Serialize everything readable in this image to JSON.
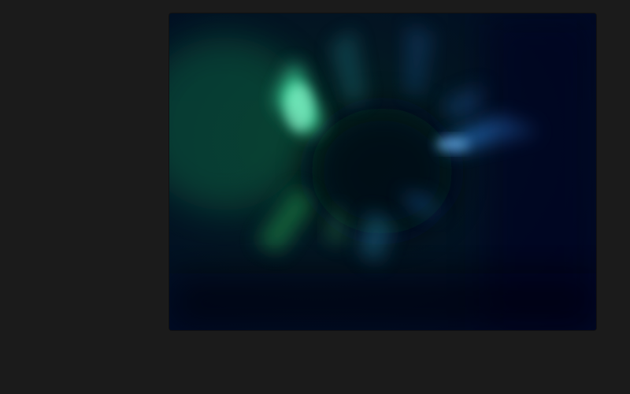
{
  "colors": {
    "page_background": "#1b1b1b",
    "wallpaper_base": "#020a14",
    "green_glow": "#3fe0a0",
    "teal_glow": "#2aa6a6",
    "blue_glow": "#2f7fd6",
    "deep_navy": "#000822"
  },
  "wallpaper": {
    "name": "abstract-blurred-light-rays"
  }
}
